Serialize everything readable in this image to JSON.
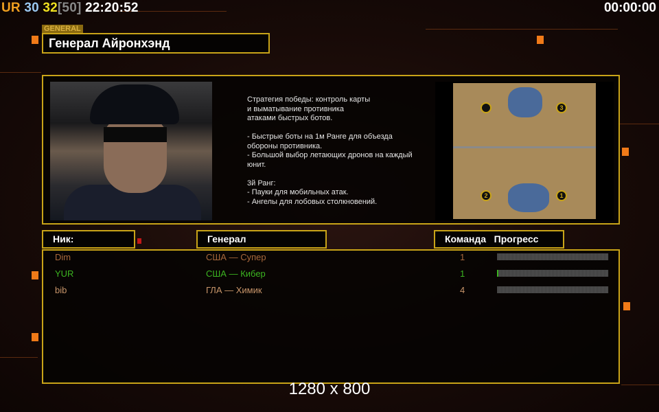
{
  "status_bar": {
    "ur": "UR",
    "n1": "30",
    "n2": "32",
    "bracket": "[50]",
    "time": "22:20:52",
    "timer": "00:00:00"
  },
  "general": {
    "tag": "GENERAL",
    "name": "Генерал Айронхэнд"
  },
  "description": "Стратегия победы: контроль карты\nи выматывание противника\nатаками быстрых ботов.\n\n- Быстрые боты на 1м Ранге для объезда\n обороны противника.\n- Большой выбор летающих дронов на каждый\nюнит.\n\n3й Ранг:\n- Пауки для мобильных атак.\n- Ангелы для лобовых столкновений.",
  "map": {
    "start_positions": [
      "1",
      "2",
      "3"
    ]
  },
  "headers": {
    "nick": "Ник:",
    "general": "Генерал",
    "team": "Команда",
    "progress": "Прогресс"
  },
  "players": [
    {
      "nick": "Dim",
      "general": "США — Супер",
      "team": "1",
      "progress": 0,
      "color": "#a8683c"
    },
    {
      "nick": "YUR",
      "general": "США — Кибер",
      "team": "1",
      "progress": 0.01,
      "color": "#3cb521"
    },
    {
      "nick": "bib",
      "general": "ГЛА — Химик",
      "team": "4",
      "progress": 0,
      "color": "#c8956a"
    }
  ],
  "resolution": "1280 x 800"
}
